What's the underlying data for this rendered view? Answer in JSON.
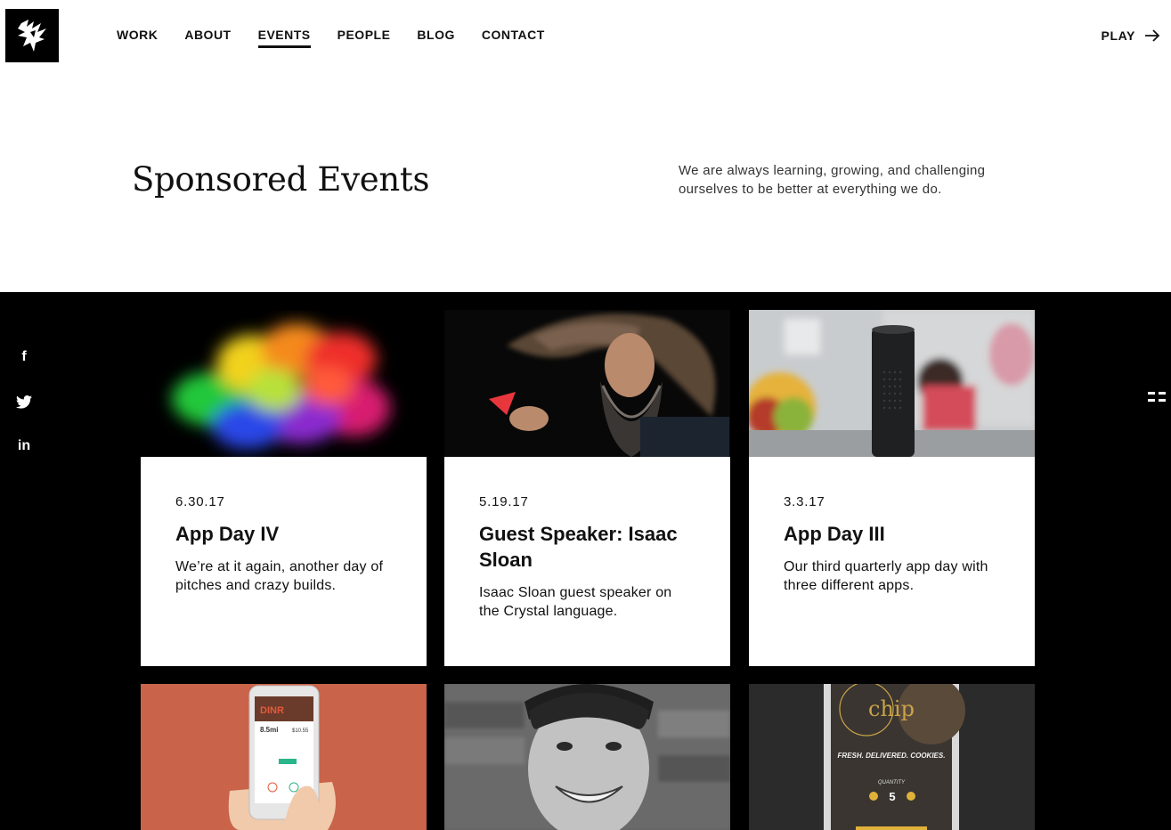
{
  "nav": {
    "items": [
      {
        "label": "WORK",
        "active": false
      },
      {
        "label": "ABOUT",
        "active": false
      },
      {
        "label": "EVENTS",
        "active": true
      },
      {
        "label": "PEOPLE",
        "active": false
      },
      {
        "label": "BLOG",
        "active": false
      },
      {
        "label": "CONTACT",
        "active": false
      }
    ],
    "play_label": "PLAY"
  },
  "hero": {
    "title": "Sponsored Events",
    "description": "We are always learning, growing, and challenging ourselves to be better at everything we do."
  },
  "social": {
    "facebook": "f",
    "linkedin": "in"
  },
  "events": [
    {
      "date": "6.30.17",
      "title": "App Day IV",
      "description": "We’re at it again, another day of pitches and crazy builds."
    },
    {
      "date": "5.19.17",
      "title": "Guest Speaker: Isaac Sloan",
      "description": "Isaac Sloan guest speaker on the Crystal language."
    },
    {
      "date": "3.3.17",
      "title": "App Day III",
      "description": "Our third quarterly app day with three different apps."
    }
  ],
  "bottom_cards": {
    "dinr": {
      "brand": "DINR",
      "price": "8.5mi",
      "amount": "$10.55"
    },
    "chip": {
      "brand": "chip",
      "tagline": "FRESH. DELIVERED. COOKIES.",
      "quantity_label": "QUANTITY",
      "quantity": "5"
    }
  },
  "colors": {
    "dark_bg": "#000000",
    "accent_orange": "#c9634a"
  }
}
